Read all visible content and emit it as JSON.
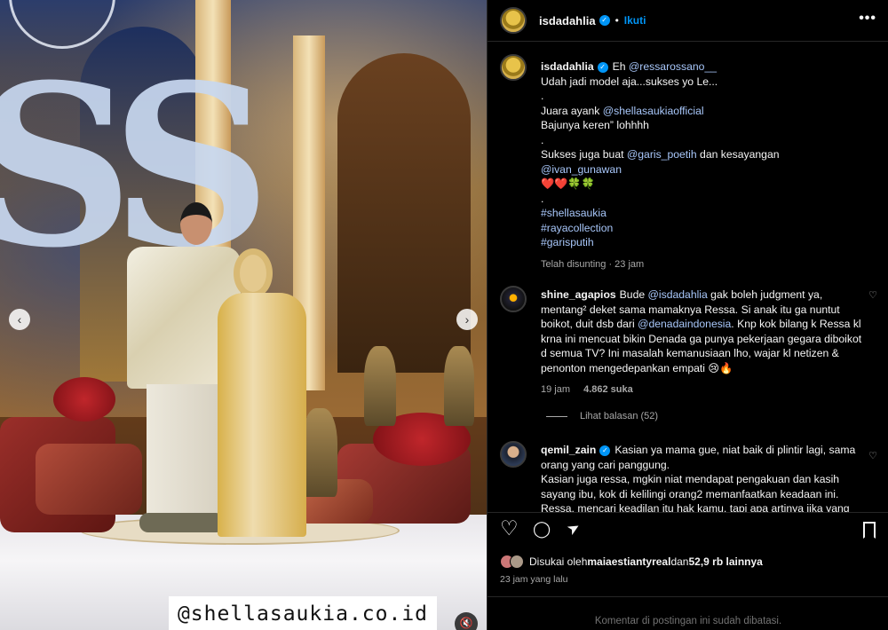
{
  "watermark": "@shellasaukia.co.id",
  "header": {
    "username": "isdadahlia",
    "verified_icon": "verified-badge-icon",
    "separator": "•",
    "follow_label": "Ikuti",
    "more_icon": "more-options-icon",
    "more_glyph": "•••"
  },
  "caption": {
    "username": "isdadahlia",
    "lines": [
      {
        "parts": [
          {
            "t": "Eh "
          },
          {
            "t": "@ressarossano__",
            "link": true
          }
        ]
      },
      {
        "parts": [
          {
            "t": "Udah jadi model aja...sukses yo Le..."
          }
        ]
      },
      {
        "parts": [
          {
            "t": "."
          }
        ]
      },
      {
        "parts": [
          {
            "t": "Juara ayank "
          },
          {
            "t": "@shellasaukiaofficial",
            "link": true
          }
        ]
      },
      {
        "parts": [
          {
            "t": "Bajunya keren” lohhhh"
          }
        ]
      },
      {
        "parts": [
          {
            "t": "."
          }
        ]
      },
      {
        "parts": [
          {
            "t": "Sukses juga buat "
          },
          {
            "t": "@garis_poetih",
            "link": true
          },
          {
            "t": " dan kesayangan"
          }
        ]
      },
      {
        "parts": [
          {
            "t": "@ivan_gunawan",
            "link": true
          }
        ]
      },
      {
        "parts": [
          {
            "t": "❤️❤️🍀🍀"
          }
        ]
      },
      {
        "parts": [
          {
            "t": "."
          }
        ]
      },
      {
        "parts": [
          {
            "t": "#shellasaukia",
            "link": true
          }
        ]
      },
      {
        "parts": [
          {
            "t": "#rayacollection",
            "link": true
          }
        ]
      },
      {
        "parts": [
          {
            "t": "#garisputih",
            "link": true
          }
        ]
      }
    ],
    "meta": "Telah disunting · 23 jam"
  },
  "comments": [
    {
      "username": "shine_agapios",
      "verified": false,
      "parts": [
        {
          "t": "Bude "
        },
        {
          "t": "@isdadahlia",
          "link": true
        },
        {
          "t": " gak boleh judgment ya, mentang² deket sama mamaknya Ressa. Si anak itu ga nuntut boikot, duit dsb dari "
        },
        {
          "t": "@denadaindonesia",
          "link": true
        },
        {
          "t": ". Knp kok bilang k Ressa kl krna ini mencuat bikin Denada ga punya pekerjaan gegara diboikot d semua TV? Ini masalah kemanusiaan lho, wajar kl netizen & penonton mengedepankan empati 😢🔥"
        }
      ],
      "time": "19 jam",
      "likes": "4.862 suka",
      "replies": "Lihat balasan (52)"
    },
    {
      "username": "qemil_zain",
      "verified": true,
      "parts": [
        {
          "t": "Kasian ya mama gue, niat baik di plintir lagi, sama orang yang cari panggung."
        },
        {
          "br": true
        },
        {
          "t": "Kasian juga ressa, mgkin niat mendapat pengakuan dan kasih sayang ibu, kok di kelilingi orang2 memanfaatkan keadaan ini."
        },
        {
          "br": true
        },
        {
          "t": "Ressa, mencari keadilan itu hak kamu, tapi apa artinya jika yang"
        }
      ]
    }
  ],
  "actions": {
    "like_glyph": "♡",
    "comment_glyph": "◯",
    "share_glyph": "➤",
    "save_glyph": "🔖"
  },
  "liked_by": {
    "prefix": "Disukai oleh ",
    "user": "maiaestiantyreal",
    "middle": " dan ",
    "count": "52,9 rb lainnya"
  },
  "posted_time": "23 jam yang lalu",
  "comments_limited": "Komentar di postingan ini sudah dibatasi.",
  "colors": {
    "link": "#a8c7fa",
    "accent": "#0095f6",
    "muted": "#a8a8a8"
  }
}
